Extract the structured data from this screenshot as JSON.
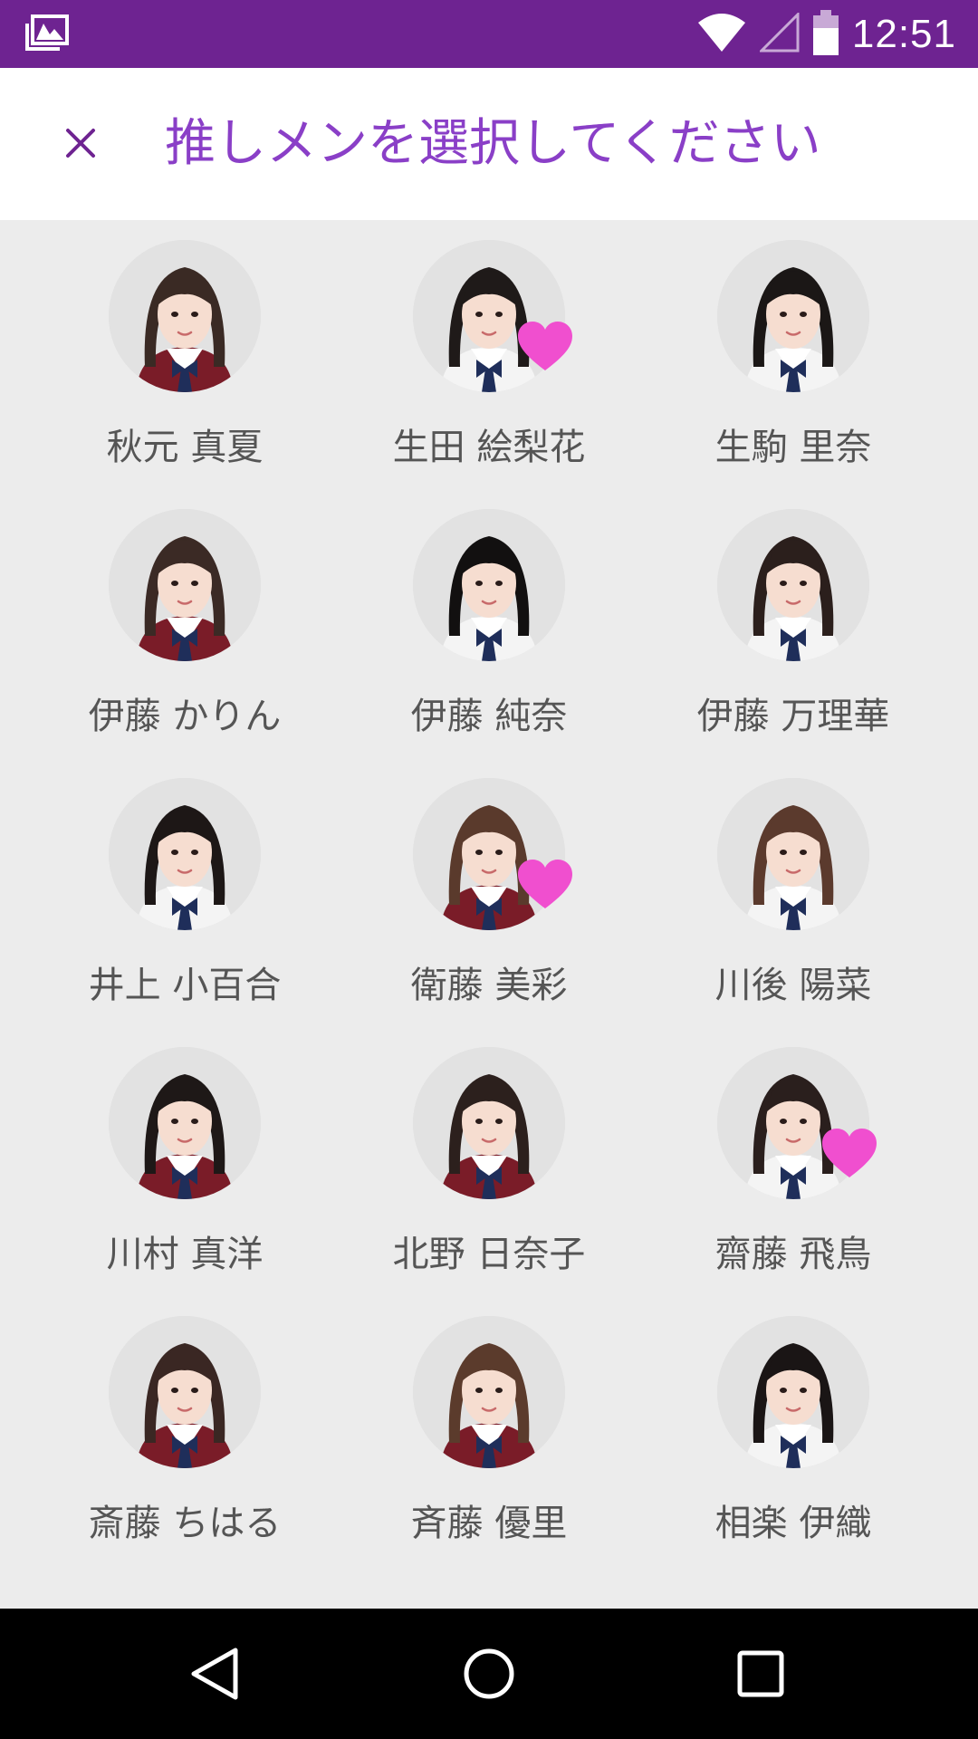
{
  "status_bar": {
    "time": "12:51",
    "icons": [
      "gallery-notification-icon",
      "wifi-icon",
      "cellular-signal-icon",
      "battery-icon"
    ]
  },
  "header": {
    "close_glyph": "×",
    "title": "推しメンを選択してください"
  },
  "colors": {
    "status_bar": "#6e2391",
    "title": "#8a3fc7",
    "heart": "#f04fcf",
    "background": "#ececec"
  },
  "members": [
    {
      "name": "秋元 真夏",
      "favorite": false,
      "hair": "#3a2a24",
      "uniform": "maroon"
    },
    {
      "name": "生田 絵梨花",
      "favorite": true,
      "hair": "#1f1a19",
      "uniform": "white"
    },
    {
      "name": "生駒 里奈",
      "favorite": false,
      "hair": "#1b1716",
      "uniform": "white"
    },
    {
      "name": "伊藤 かりん",
      "favorite": false,
      "hair": "#3b2a25",
      "uniform": "maroon"
    },
    {
      "name": "伊藤 純奈",
      "favorite": false,
      "hair": "#121010",
      "uniform": "white"
    },
    {
      "name": "伊藤 万理華",
      "favorite": false,
      "hair": "#2b1f1c",
      "uniform": "white"
    },
    {
      "name": "井上 小百合",
      "favorite": false,
      "hair": "#1d1716",
      "uniform": "white"
    },
    {
      "name": "衛藤 美彩",
      "favorite": true,
      "hair": "#5a3a2c",
      "uniform": "maroon"
    },
    {
      "name": "川後 陽菜",
      "favorite": false,
      "hair": "#5b3a2d",
      "uniform": "white"
    },
    {
      "name": "川村 真洋",
      "favorite": false,
      "hair": "#1e1817",
      "uniform": "maroon"
    },
    {
      "name": "北野 日奈子",
      "favorite": false,
      "hair": "#2c201d",
      "uniform": "maroon"
    },
    {
      "name": "齋藤 飛鳥",
      "favorite": true,
      "hair": "#2a1f1d",
      "uniform": "white"
    },
    {
      "name": "斎藤 ちはる",
      "favorite": false,
      "hair": "#3a2723",
      "uniform": "maroon"
    },
    {
      "name": "斉藤 優里",
      "favorite": false,
      "hair": "#5b3b2c",
      "uniform": "maroon"
    },
    {
      "name": "相楽 伊織",
      "favorite": false,
      "hair": "#1a1515",
      "uniform": "white"
    }
  ],
  "nav": {
    "buttons": [
      "back-icon",
      "home-icon",
      "recents-icon"
    ]
  }
}
